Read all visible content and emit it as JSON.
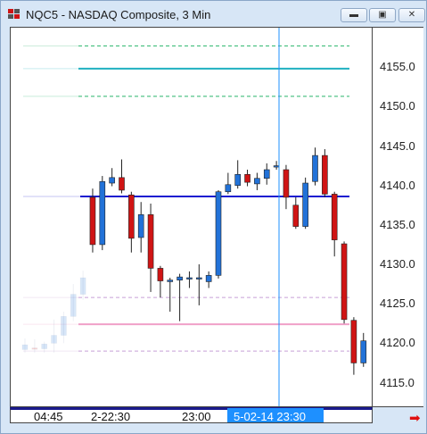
{
  "window": {
    "title": "NQC5 - NASDAQ Composite, 3 Min",
    "buttons": [
      "minimize",
      "restore",
      "close"
    ]
  },
  "colors": {
    "up_candle": "#2272d8",
    "down_candle": "#d01414",
    "cursor": "#1e90ff",
    "hline_main": "#1a1ad0",
    "hline_teal": "#1fb0c0",
    "hline_green": "#27b56a",
    "hline_pink": "#f0a0c8",
    "hline_lilac": "#c8a0d8"
  },
  "y_axis": {
    "labels": [
      "4155.0",
      "4150.0",
      "4145.0",
      "4140.0",
      "4135.0",
      "4130.0",
      "4125.0",
      "4120.0",
      "4115.0"
    ]
  },
  "x_axis": {
    "labels": [
      "04:45",
      "2-22:30",
      "23:00",
      "23:30"
    ],
    "cursor_label": "5-02-14 23:30"
  },
  "chart_data": {
    "type": "candlestick",
    "ylim": [
      4112,
      4160
    ],
    "hlines": [
      {
        "price": 4157.7,
        "style": "dashed",
        "color": "#27b56a"
      },
      {
        "price": 4154.8,
        "style": "solid",
        "color": "#1fb0c0"
      },
      {
        "price": 4151.3,
        "style": "dashed",
        "color": "#27b56a"
      },
      {
        "price": 4138.6,
        "style": "solid",
        "color": "#1a1ad0"
      },
      {
        "price": 4125.8,
        "style": "dashed",
        "color": "#c8a0d8"
      },
      {
        "price": 4122.4,
        "style": "solid",
        "color": "#f0a0c8"
      },
      {
        "price": 4119.0,
        "style": "dashed",
        "color": "#c8a0d8"
      }
    ],
    "candles": [
      {
        "o": 4119.2,
        "h": 4120.6,
        "l": 4118.8,
        "c": 4119.8,
        "faded": true
      },
      {
        "o": 4119.4,
        "h": 4120.5,
        "l": 4118.8,
        "c": 4119.3,
        "faded": true
      },
      {
        "o": 4119.3,
        "h": 4120.2,
        "l": 4118.8,
        "c": 4119.9,
        "faded": true
      },
      {
        "o": 4120.0,
        "h": 4123.0,
        "l": 4118.8,
        "c": 4121.0,
        "faded": true
      },
      {
        "o": 4121.0,
        "h": 4124.0,
        "l": 4120.0,
        "c": 4123.4,
        "faded": true
      },
      {
        "o": 4123.4,
        "h": 4127.5,
        "l": 4122.8,
        "c": 4126.2,
        "faded": true
      },
      {
        "o": 4126.2,
        "h": 4129.2,
        "l": 4125.5,
        "c": 4128.3,
        "faded": true
      },
      {
        "o": 4138.5,
        "h": 4139.6,
        "l": 4131.5,
        "c": 4132.5
      },
      {
        "o": 4132.5,
        "h": 4141.2,
        "l": 4131.8,
        "c": 4140.5
      },
      {
        "o": 4140.3,
        "h": 4142.2,
        "l": 4139.9,
        "c": 4141.0
      },
      {
        "o": 4141.0,
        "h": 4143.3,
        "l": 4139.0,
        "c": 4139.4
      },
      {
        "o": 4138.8,
        "h": 4139.2,
        "l": 4131.5,
        "c": 4133.3
      },
      {
        "o": 4133.4,
        "h": 4137.9,
        "l": 4131.5,
        "c": 4136.3
      },
      {
        "o": 4136.3,
        "h": 4137.7,
        "l": 4126.5,
        "c": 4129.5
      },
      {
        "o": 4129.5,
        "h": 4129.8,
        "l": 4125.8,
        "c": 4127.9
      },
      {
        "o": 4127.8,
        "h": 4128.3,
        "l": 4124.0,
        "c": 4128.0
      },
      {
        "o": 4128.0,
        "h": 4128.8,
        "l": 4122.8,
        "c": 4128.4
      },
      {
        "o": 4128.3,
        "h": 4129.1,
        "l": 4127.0,
        "c": 4128.3
      },
      {
        "o": 4128.3,
        "h": 4130.0,
        "l": 4124.8,
        "c": 4128.3
      },
      {
        "o": 4127.8,
        "h": 4129.1,
        "l": 4127.0,
        "c": 4128.6
      },
      {
        "o": 4128.6,
        "h": 4139.4,
        "l": 4128.2,
        "c": 4139.2
      },
      {
        "o": 4139.2,
        "h": 4141.6,
        "l": 4138.9,
        "c": 4140.1
      },
      {
        "o": 4140.0,
        "h": 4143.2,
        "l": 4139.6,
        "c": 4141.4
      },
      {
        "o": 4141.4,
        "h": 4142.0,
        "l": 4139.9,
        "c": 4140.4
      },
      {
        "o": 4140.2,
        "h": 4141.6,
        "l": 4139.4,
        "c": 4140.9
      },
      {
        "o": 4140.9,
        "h": 4142.8,
        "l": 4140.1,
        "c": 4142.0
      },
      {
        "o": 4142.5,
        "h": 4143.1,
        "l": 4142.0,
        "c": 4142.5
      },
      {
        "o": 4142.0,
        "h": 4142.6,
        "l": 4137.0,
        "c": 4138.5
      },
      {
        "o": 4137.5,
        "h": 4138.5,
        "l": 4134.5,
        "c": 4134.8
      },
      {
        "o": 4134.8,
        "h": 4141.0,
        "l": 4134.5,
        "c": 4140.3
      },
      {
        "o": 4140.5,
        "h": 4144.8,
        "l": 4140.0,
        "c": 4143.8
      },
      {
        "o": 4143.8,
        "h": 4144.6,
        "l": 4138.5,
        "c": 4138.9
      },
      {
        "o": 4138.9,
        "h": 4139.2,
        "l": 4131.0,
        "c": 4133.1
      },
      {
        "o": 4132.6,
        "h": 4132.9,
        "l": 4122.5,
        "c": 4123.0
      },
      {
        "o": 4122.9,
        "h": 4123.3,
        "l": 4116.0,
        "c": 4117.5
      },
      {
        "o": 4117.5,
        "h": 4121.3,
        "l": 4117.0,
        "c": 4120.3
      }
    ],
    "cursor_index": 28
  }
}
